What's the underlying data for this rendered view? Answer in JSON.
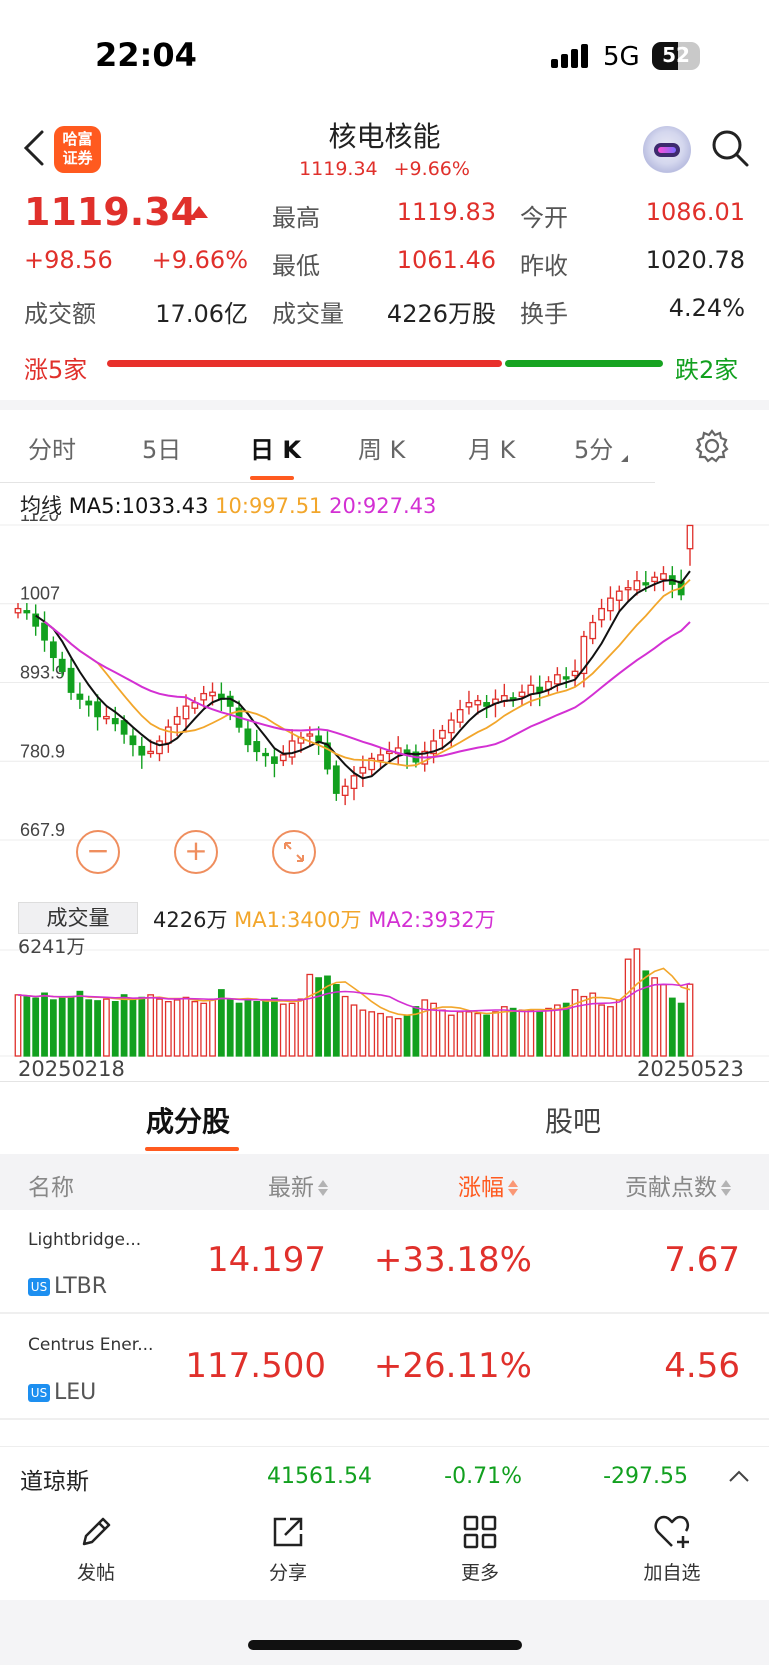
{
  "status_bar": {
    "time": "22:04",
    "network": "5G",
    "battery": "52"
  },
  "header": {
    "broker_logo": "哈富\n证券",
    "title": "核电核能",
    "price": "1119.34",
    "change_pct": "+9.66%"
  },
  "quote": {
    "price": "1119.34",
    "change": "+98.56",
    "change_pct": "+9.66%",
    "high_label": "最高",
    "high": "1119.83",
    "open_label": "今开",
    "open": "1086.01",
    "low_label": "最低",
    "low": "1061.46",
    "prev_close_label": "昨收",
    "prev_close": "1020.78",
    "turnover_label": "成交额",
    "turnover": "17.06亿",
    "volume_label": "成交量",
    "volume": "4226万股",
    "turnover_rate_label": "换手",
    "turnover_rate": "4.24%",
    "up_count": "涨5家",
    "down_count": "跌2家",
    "up_ratio": 0.714
  },
  "tabs": [
    "分时",
    "5日",
    "日 K",
    "周 K",
    "月 K",
    "5分"
  ],
  "active_tab": "日 K",
  "ma": {
    "label": "均线",
    "ma5": "MA5:1033.43",
    "ma10": "10:997.51",
    "ma20": "20:927.43"
  },
  "colors": {
    "up": "#e0302b",
    "down": "#12a01f",
    "ma5": "#111111",
    "ma10": "#f2a62b",
    "ma20": "#d330d3",
    "accent": "#ff5a1f"
  },
  "chart_data": {
    "type": "candlestick",
    "yaxis_ticks": [
      "1120",
      "1007",
      "893.9",
      "780.9",
      "667.9"
    ],
    "ylim": [
      667.9,
      1120
    ],
    "x_start": "20250218",
    "x_end": "20250523",
    "last": {
      "open": 1086.01,
      "high": 1119.83,
      "low": 1061.46,
      "close": 1119.34
    }
  },
  "volume": {
    "label": "成交量",
    "value": "4226万",
    "ma1": "MA1:3400万",
    "ma2": "MA2:3932万",
    "max_tick": "6241万",
    "date_start": "20250218",
    "date_end": "20250523"
  },
  "sub_tabs": [
    "成分股",
    "股吧"
  ],
  "table": {
    "headers": [
      "名称",
      "最新",
      "涨幅",
      "贡献点数"
    ],
    "rows": [
      {
        "name": "Lightbridge...",
        "market": "US",
        "code": "LTBR",
        "price": "14.197",
        "change": "+33.18%",
        "points": "7.67"
      },
      {
        "name": "Centrus Ener...",
        "market": "US",
        "code": "LEU",
        "price": "117.500",
        "change": "+26.11%",
        "points": "4.56"
      }
    ]
  },
  "ticker": {
    "name": "道琼斯",
    "value": "41561.54",
    "change_pct": "-0.71%",
    "change": "-297.55"
  },
  "bottom_nav": [
    "发帖",
    "分享",
    "更多",
    "加自选"
  ]
}
